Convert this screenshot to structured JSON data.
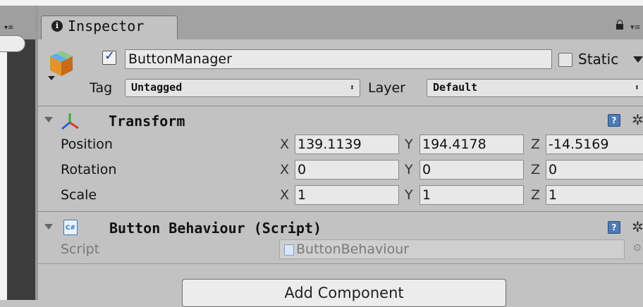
{
  "tab": {
    "label": "Inspector",
    "info_glyph": "i",
    "menu_glyph": "▾≡"
  },
  "left_panel": {
    "menu_glyph": "▾≡"
  },
  "game_object": {
    "active": true,
    "name": "ButtonManager",
    "static_label": "Static",
    "static_checked": false,
    "tag_label": "Tag",
    "tag_value": "Untagged",
    "layer_label": "Layer",
    "layer_value": "Default",
    "dropdown_arrow": "⬍"
  },
  "transform": {
    "title": "Transform",
    "help_glyph": "?",
    "gear_glyph": "✲",
    "axes": {
      "x": "X",
      "y": "Y",
      "z": "Z"
    },
    "rows": [
      {
        "label": "Position",
        "x": "139.1139",
        "y": "194.4178",
        "z": "-14.5169"
      },
      {
        "label": "Rotation",
        "x": "0",
        "y": "0",
        "z": "0"
      },
      {
        "label": "Scale",
        "x": "1",
        "y": "1",
        "z": "1"
      }
    ]
  },
  "button_behaviour": {
    "title": "Button Behaviour (Script)",
    "icon_glyph": "C#",
    "help_glyph": "?",
    "gear_glyph": "✲",
    "script_label": "Script",
    "script_value": "ButtonBehaviour",
    "picker_glyph": "⊙"
  },
  "add_component": {
    "label": "Add Component"
  },
  "colors": {
    "panel_bg": "#c2c2c2",
    "tab_bar_bg": "#a2a2a2",
    "checkmark": "#0c3d93",
    "help_icon": "#4d7bb6",
    "script_icon_border": "#3f76b5"
  }
}
